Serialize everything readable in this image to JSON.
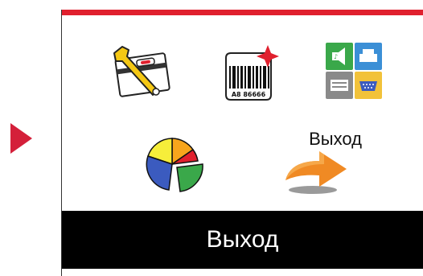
{
  "screen": {
    "accent_color": "#e0202e",
    "selection_marker_color": "#d4203a",
    "menu_items": [
      {
        "icon": "settings-wrench-icon"
      },
      {
        "icon": "barcode-label-icon",
        "text": "A8 86666"
      },
      {
        "icon": "interfaces-icon"
      },
      {
        "icon": "pie-chart-icon"
      },
      {
        "icon": "exit-arrow-icon"
      }
    ],
    "hover_label": "Выход",
    "selected_title": "Выход"
  }
}
